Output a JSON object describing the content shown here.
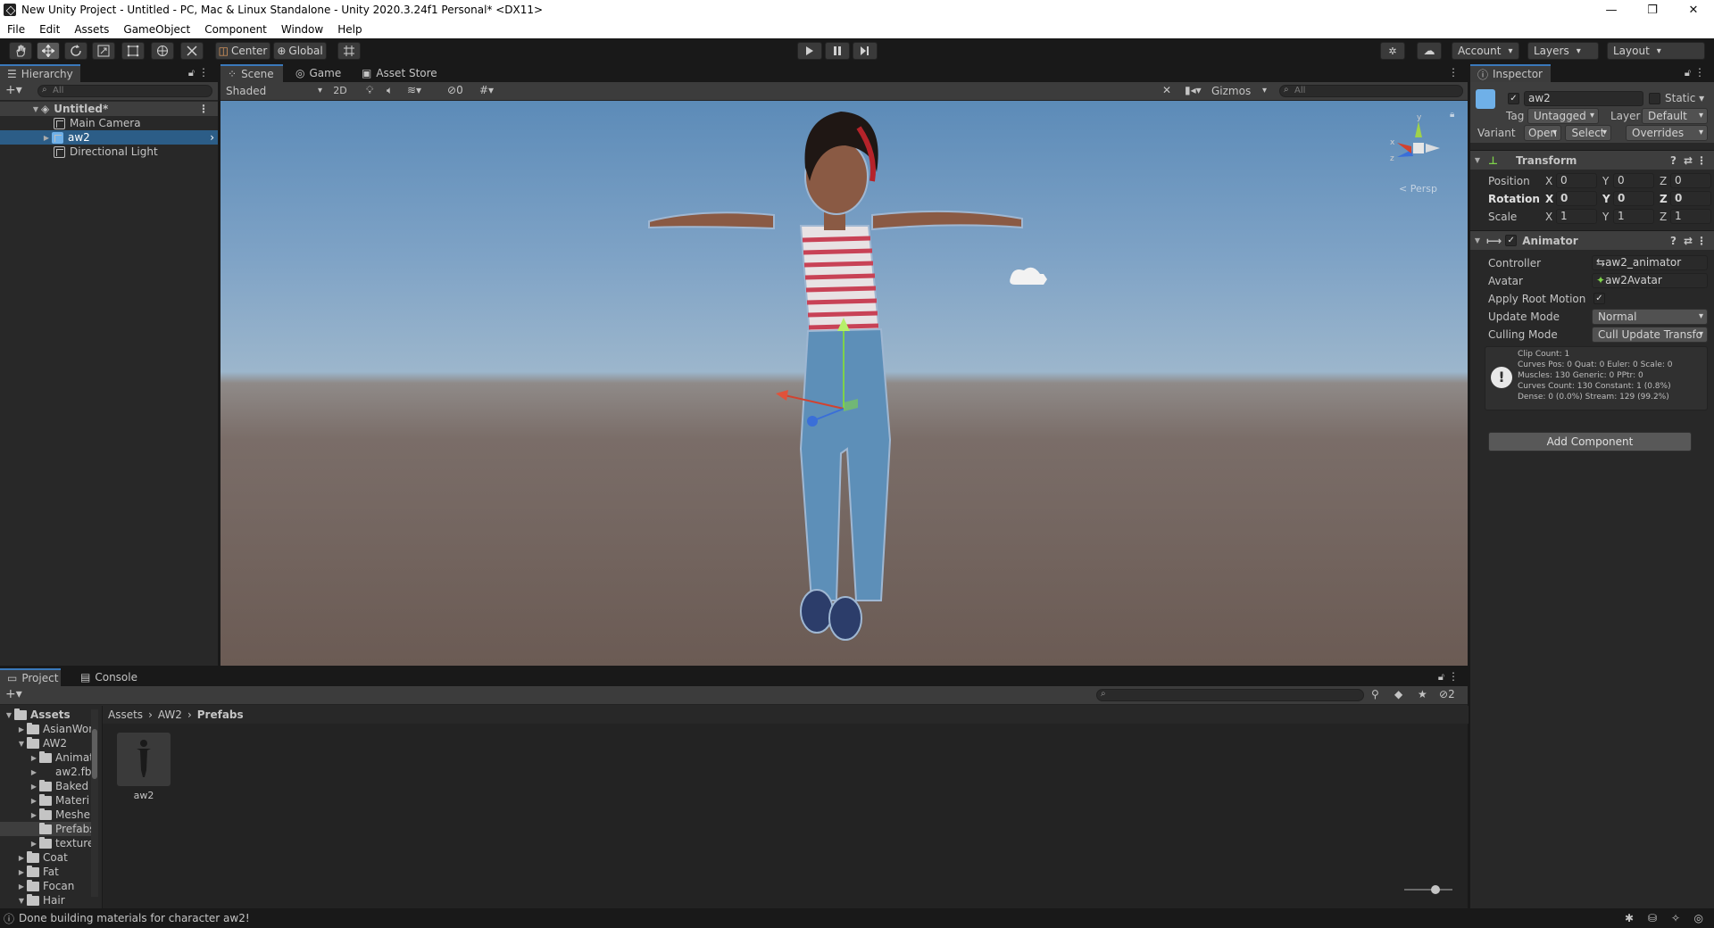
{
  "window": {
    "title": "New Unity Project - Untitled - PC, Mac & Linux Standalone - Unity 2020.3.24f1 Personal* <DX11>"
  },
  "menu": [
    "File",
    "Edit",
    "Assets",
    "GameObject",
    "Component",
    "Window",
    "Help"
  ],
  "toolbar": {
    "pivot": "Center",
    "space": "Global",
    "account": "Account",
    "layers": "Layers",
    "layout": "Layout"
  },
  "hierarchy": {
    "tab": "Hierarchy",
    "search_placeholder": "All",
    "scene": "Untitled*",
    "items": [
      "Main Camera",
      "aw2",
      "Directional Light"
    ]
  },
  "scene": {
    "tabs": [
      "Scene",
      "Game",
      "Asset Store"
    ],
    "shading": "Shaded",
    "mode2d": "2D",
    "hidden_count": "0",
    "gizmos": "Gizmos",
    "search_placeholder": "All",
    "persp": "< Persp"
  },
  "inspector": {
    "tab": "Inspector",
    "object_name": "aw2",
    "static": "Static",
    "tag_label": "Tag",
    "tag": "Untagged",
    "layer_label": "Layer",
    "layer": "Default",
    "variant_label": "Variant",
    "open": "Open",
    "select": "Select",
    "overrides": "Overrides",
    "transform": {
      "title": "Transform",
      "position_label": "Position",
      "rotation_label": "Rotation",
      "scale_label": "Scale",
      "position": [
        "0",
        "0",
        "0"
      ],
      "rotation": [
        "0",
        "0",
        "0"
      ],
      "scale": [
        "1",
        "1",
        "1"
      ]
    },
    "animator": {
      "title": "Animator",
      "controller_label": "Controller",
      "controller": "aw2_animator",
      "avatar_label": "Avatar",
      "avatar": "aw2Avatar",
      "root_motion_label": "Apply Root Motion",
      "update_mode_label": "Update Mode",
      "update_mode": "Normal",
      "culling_mode_label": "Culling Mode",
      "culling_mode": "Cull Update Transfo",
      "info": [
        "Clip Count: 1",
        "Curves Pos: 0 Quat: 0 Euler: 0 Scale: 0",
        "Muscles: 130 Generic: 0 PPtr: 0",
        "Curves Count: 130 Constant: 1 (0.8%)",
        "Dense: 0 (0.0%) Stream: 129 (99.2%)"
      ]
    },
    "add_component": "Add Component"
  },
  "project": {
    "tabs": [
      "Project",
      "Console"
    ],
    "breadcrumb": [
      "Assets",
      "AW2",
      "Prefabs"
    ],
    "tree": [
      {
        "label": "Assets",
        "level": 0,
        "expanded": true
      },
      {
        "label": "AsianWor",
        "level": 1
      },
      {
        "label": "AW2",
        "level": 1,
        "expanded": true
      },
      {
        "label": "Animat",
        "level": 2
      },
      {
        "label": "aw2.fb",
        "level": 2
      },
      {
        "label": "Baked",
        "level": 2
      },
      {
        "label": "Materi",
        "level": 2
      },
      {
        "label": "Meshe",
        "level": 2
      },
      {
        "label": "Prefabs",
        "level": 2,
        "selected": true
      },
      {
        "label": "texture",
        "level": 2
      },
      {
        "label": "Coat",
        "level": 1
      },
      {
        "label": "Fat",
        "level": 1
      },
      {
        "label": "Focan",
        "level": 1
      },
      {
        "label": "Hair",
        "level": 1,
        "expanded": true
      }
    ],
    "asset": "aw2",
    "hidden_count": "2"
  },
  "status": {
    "message": "Done building materials for character aw2!"
  }
}
